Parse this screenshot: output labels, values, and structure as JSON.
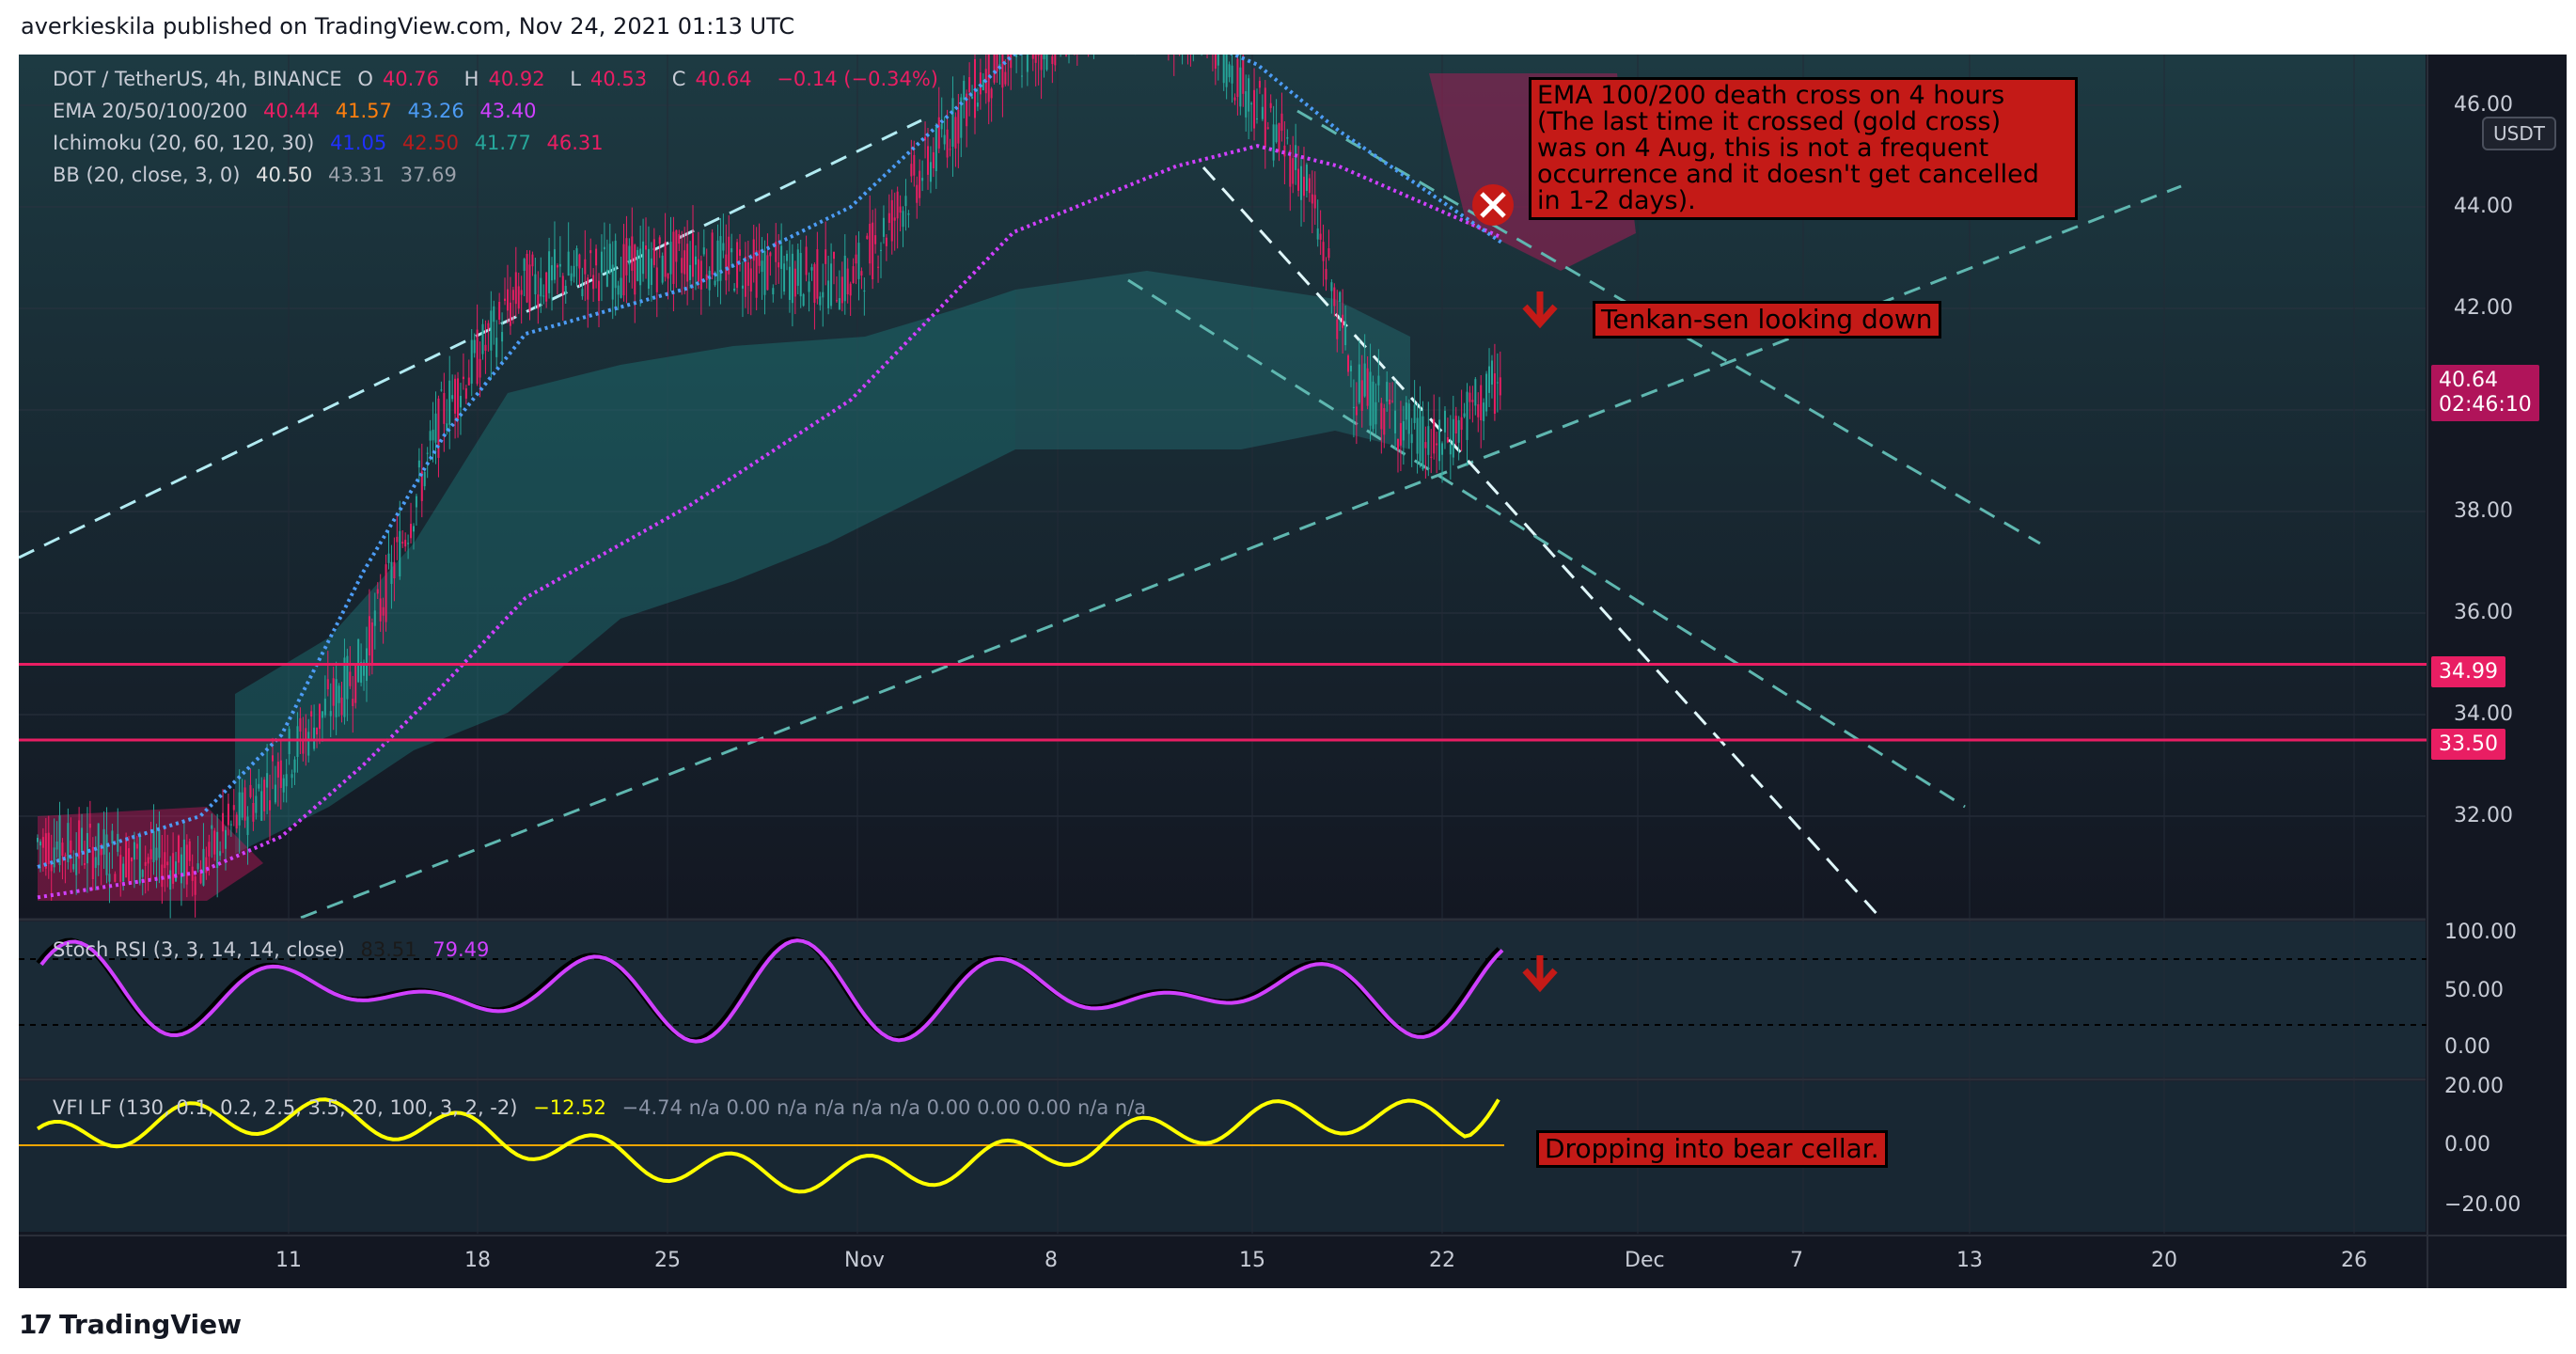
{
  "header": {
    "text": "averkieskila published on TradingView.com, Nov 24, 2021 01:13 UTC"
  },
  "footer": {
    "logo_text": "TradingView"
  },
  "colors": {
    "bg": "#131722",
    "pink": "#e91e63",
    "annotation": "#c41a17",
    "ema20": "#e91e63",
    "ema50": "#ff7f0e",
    "ema100": "#4c9cf5",
    "ema200": "#d040ff",
    "tenkan": "#2030ff",
    "kijun": "#b71c1c",
    "stoch": "#d040ff",
    "vfi": "#ffff00"
  },
  "legend": {
    "symbol": "DOT / TetherUS, 4h, BINANCE",
    "ohlc": [
      {
        "k": "O",
        "v": "40.76"
      },
      {
        "k": "H",
        "v": "40.92"
      },
      {
        "k": "L",
        "v": "40.53"
      },
      {
        "k": "C",
        "v": "40.64"
      },
      {
        "k": "",
        "v": "−0.14 (−0.34%)"
      }
    ],
    "ema": {
      "name": "EMA 20/50/100/200",
      "values": [
        "40.44",
        "41.57",
        "43.26",
        "43.40"
      ]
    },
    "ichimoku": {
      "name": "Ichimoku (20, 60, 120, 30)",
      "values": [
        "41.05",
        "42.50",
        "41.77",
        "46.31"
      ]
    },
    "bb": {
      "name": "BB (20, close, 3, 0)",
      "values": [
        "40.50",
        "43.31",
        "37.69"
      ]
    }
  },
  "stoch": {
    "name": "Stoch RSI (3, 3, 14, 14, close)",
    "values": [
      "83.51",
      "79.49"
    ]
  },
  "vfi": {
    "name": "VFI LF (130, 0.1, 0.2, 2.5, 3.5, 20, 100, 3, 2, -2)",
    "value": "−12.52",
    "extra": "−4.74  n/a  0.00  n/a  n/a  n/a  n/a  0.00  0.00  0.00  n/a  n/a"
  },
  "annotations": {
    "ema_cross": [
      "EMA 100/200 death cross on 4 hours",
      "(The last time it crossed (gold cross)",
      "was on 4 Aug, this is not a frequent",
      "occurrence and it doesn't get cancelled",
      "in 1-2 days)."
    ],
    "tenkan": "Tenkan-sen looking down",
    "vfi": "Dropping into bear cellar."
  },
  "price_axis": {
    "currency": "USDT",
    "current_price": "40.64",
    "countdown": "02:46:10",
    "levels": [
      "34.99",
      "33.50"
    ]
  },
  "chart_data": {
    "type": "line",
    "title": "DOT / TetherUS, 4h, BINANCE",
    "xlabel": "",
    "ylabel": "",
    "x_ticks": [
      "11",
      "18",
      "25",
      "Nov",
      "8",
      "15",
      "22",
      "Dec",
      "7",
      "13",
      "20",
      "26"
    ],
    "y_ticks": [
      "32.00",
      "34.00",
      "36.00",
      "38.00",
      "40.00",
      "42.00",
      "44.00",
      "46.00"
    ],
    "ylim": [
      30,
      47
    ],
    "horizontal_levels": [
      34.99,
      33.5
    ],
    "stoch_ticks": [
      "100.00",
      "50.00",
      "0.00"
    ],
    "vfi_ticks": [
      "20.00",
      "0.00",
      "−20.00"
    ],
    "grid": true,
    "series": [
      {
        "name": "EMA 200",
        "color": "#d040ff",
        "points": [
          [
            0,
            30.4
          ],
          [
            10,
            30.9
          ],
          [
            15,
            31.6
          ],
          [
            20,
            33
          ],
          [
            25,
            34.6
          ],
          [
            30,
            36.3
          ],
          [
            40,
            38.1
          ],
          [
            50,
            40.2
          ],
          [
            60,
            43.5
          ],
          [
            70,
            44.8
          ],
          [
            75,
            45.2
          ],
          [
            80,
            44.8
          ],
          [
            90,
            43.4
          ]
        ]
      },
      {
        "name": "EMA 100",
        "color": "#4c9cf5",
        "points": [
          [
            0,
            31
          ],
          [
            10,
            32
          ],
          [
            15,
            33.6
          ],
          [
            20,
            36.8
          ],
          [
            25,
            39.5
          ],
          [
            30,
            41.5
          ],
          [
            40,
            42.4
          ],
          [
            50,
            44
          ],
          [
            60,
            47
          ],
          [
            70,
            47.5
          ],
          [
            75,
            46.8
          ],
          [
            80,
            45.5
          ],
          [
            90,
            43.3
          ]
        ]
      }
    ]
  }
}
